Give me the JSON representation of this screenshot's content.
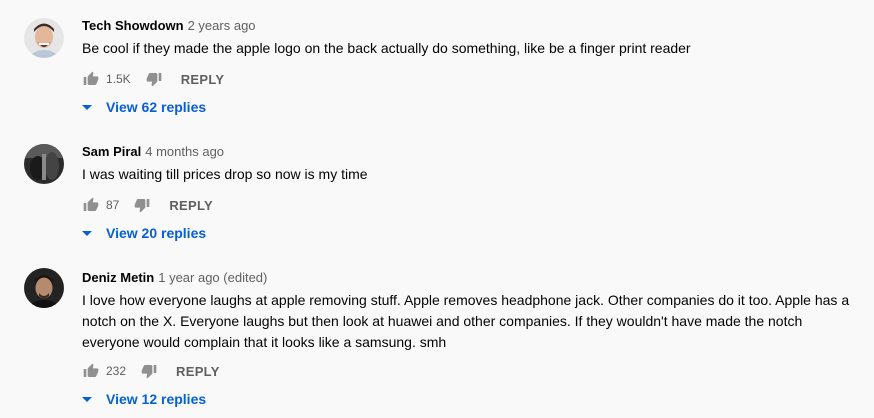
{
  "comments": [
    {
      "author": "Tech Showdown",
      "time": "2 years ago",
      "text": "Be cool if they made the apple logo on the back actually do something, like be a finger print reader",
      "likes": "1.5K",
      "reply_label": "REPLY",
      "view_replies": "View 62 replies",
      "avatar_icon": "avatar-man-smiling",
      "avatar_bg": "#e8e8e8"
    },
    {
      "author": "Sam Piral",
      "time": "4 months ago",
      "text": "I was waiting till prices drop so now is my time",
      "likes": "87",
      "reply_label": "REPLY",
      "view_replies": "View 20 replies",
      "avatar_icon": "avatar-dark-photo",
      "avatar_bg": "#3a3a3a"
    },
    {
      "author": "Deniz Metin",
      "time": "1 year ago (edited)",
      "text": "I love how everyone laughs at apple removing stuff. Apple removes headphone jack. Other companies do it too. Apple has a notch on the X. Everyone laughs but then look at huawei and other companies. If they wouldn't have made the notch everyone would complain that it looks like a samsung. smh",
      "likes": "232",
      "reply_label": "REPLY",
      "view_replies": "View 12 replies",
      "avatar_icon": "avatar-man-portrait",
      "avatar_bg": "#2a2a2a"
    }
  ],
  "colors": {
    "background": "#f9f9f9",
    "link": "#065fd4",
    "secondary_text": "#606060",
    "icon": "#909090"
  }
}
